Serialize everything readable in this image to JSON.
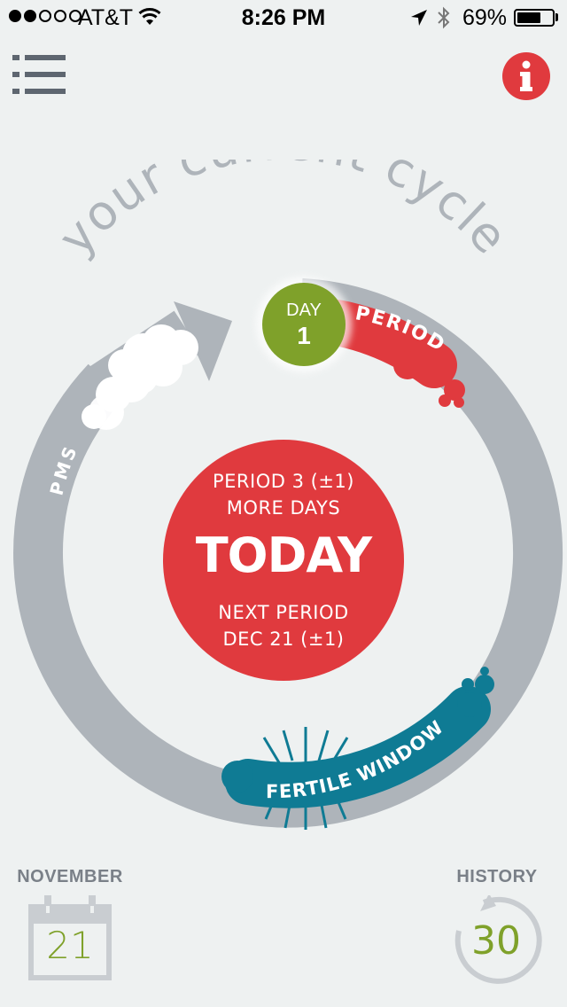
{
  "status_bar": {
    "carrier": "AT&T",
    "time": "8:26 PM",
    "battery_percent": "69%",
    "battery_level": 0.69,
    "signal_bars_filled": 2,
    "signal_bars_total": 5
  },
  "header": {
    "menu_icon": "list-icon",
    "info_icon": "info-icon"
  },
  "cycle": {
    "title": "your current cycle",
    "day_label": "DAY",
    "day_number": "1",
    "period_label": "PERIOD",
    "pms_label": "PMS",
    "fertile_label": "FERTILE WINDOW",
    "center": {
      "line1": "PERIOD 3 (±1)",
      "line2": "MORE DAYS",
      "headline": "TODAY",
      "line3": "NEXT PERIOD",
      "line4": "DEC 21 (±1)"
    }
  },
  "footer": {
    "month_label": "NOVEMBER",
    "calendar_day": "21",
    "history_label": "HISTORY",
    "history_value": "30"
  },
  "colors": {
    "background": "#eef1f1",
    "ring": "#aeb4ba",
    "period_red": "#e03a3e",
    "fertile_teal": "#0f7b94",
    "day_green": "#7fa12a",
    "label_gray": "#7a8088"
  }
}
